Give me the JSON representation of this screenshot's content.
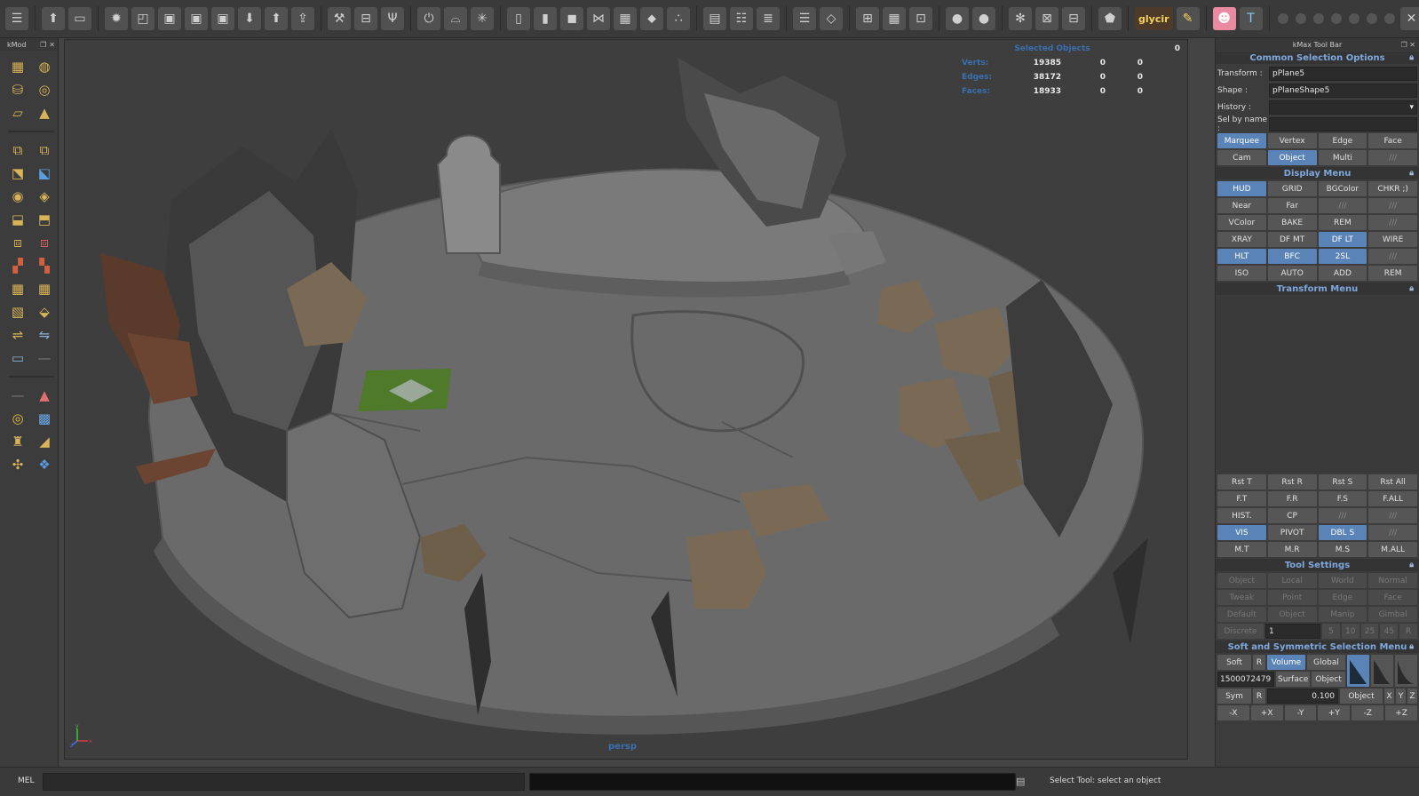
{
  "top_toolbar": {
    "groups": [
      [
        "layers-icon",
        "window-icon"
      ],
      [
        "gear-icon",
        "render-icon",
        "save-icon",
        "save-as-icon",
        "export-icon",
        "download-icon",
        "upload-icon",
        "upload-all-icon"
      ],
      [
        "tools-icon",
        "ruler-icon",
        "usb-icon"
      ],
      [
        "power-icon",
        "bevel-icon",
        "sparkle-icon"
      ],
      [
        "phone-icon",
        "tablet-icon",
        "cube-icon",
        "share-icon",
        "checker-icon",
        "tag-icon",
        "nodes-icon"
      ],
      [
        "table-icon",
        "list-icon",
        "stack-icon"
      ],
      [
        "outliner-icon",
        "plane-icon"
      ],
      [
        "grid-view-icon",
        "grid-icon",
        "uv-icon"
      ],
      [
        "thumbs-up-icon",
        "thumbs-down-icon"
      ],
      [
        "settings-icon",
        "close-x-icon",
        "edit-icon"
      ],
      [
        "pentagon-icon"
      ]
    ],
    "logo_text": "glycir",
    "window_controls": "✕"
  },
  "left_panel": {
    "title": "kMod",
    "rows": 18
  },
  "viewport": {
    "hud": {
      "title": "Selected Objects",
      "title_value": "0",
      "rows": [
        {
          "label": "Verts:",
          "v1": "19385",
          "v2": "0",
          "v3": "0"
        },
        {
          "label": "Edges:",
          "v1": "38172",
          "v2": "0",
          "v3": "0"
        },
        {
          "label": "Faces:",
          "v1": "18933",
          "v2": "0",
          "v3": "0"
        }
      ]
    },
    "camera_name": "persp",
    "axis": {
      "y": "y",
      "x": "x",
      "z": "z"
    }
  },
  "right_panel": {
    "title": "kMax Tool Bar",
    "common_selection": {
      "header": "Common Selection Options",
      "transform_label": "Transform :",
      "transform_value": "pPlane5",
      "shape_label": "Shape :",
      "shape_value": "pPlaneShape5",
      "history_label": "History :",
      "history_value": "",
      "selbyname_label": "Sel by name :",
      "selbyname_value": "",
      "buttons": [
        {
          "label": "Marquee",
          "on": true
        },
        {
          "label": "Vertex",
          "on": false
        },
        {
          "label": "Edge",
          "on": false
        },
        {
          "label": "Face",
          "on": false
        },
        {
          "label": "Cam",
          "on": false
        },
        {
          "label": "Object",
          "on": true
        },
        {
          "label": "Multi",
          "on": false
        },
        {
          "label": "///",
          "on": false
        }
      ]
    },
    "display_menu": {
      "header": "Display Menu",
      "buttons": [
        {
          "label": "HUD",
          "on": true
        },
        {
          "label": "GRID",
          "on": false
        },
        {
          "label": "BGColor",
          "on": false
        },
        {
          "label": "CHKR ;)",
          "on": false
        },
        {
          "label": "Near",
          "on": false
        },
        {
          "label": "Far",
          "on": false
        },
        {
          "label": "///",
          "on": false
        },
        {
          "label": "///",
          "on": false
        },
        {
          "label": "VColor",
          "on": false
        },
        {
          "label": "BAKE",
          "on": false
        },
        {
          "label": "REM",
          "on": false
        },
        {
          "label": "///",
          "on": false
        },
        {
          "label": "XRAY",
          "on": false
        },
        {
          "label": "DF MT",
          "on": false
        },
        {
          "label": "DF LT",
          "on": true
        },
        {
          "label": "WIRE",
          "on": false
        },
        {
          "label": "HLT",
          "on": true
        },
        {
          "label": "BFC",
          "on": true
        },
        {
          "label": "2SL",
          "on": true
        },
        {
          "label": "///",
          "on": false
        },
        {
          "label": "ISO",
          "on": false
        },
        {
          "label": "AUTO",
          "on": false
        },
        {
          "label": "ADD",
          "on": false
        },
        {
          "label": "REM",
          "on": false
        }
      ]
    },
    "transform_menu": {
      "header": "Transform Menu",
      "buttons": [
        {
          "label": "Rst T",
          "on": false
        },
        {
          "label": "Rst R",
          "on": false
        },
        {
          "label": "Rst S",
          "on": false
        },
        {
          "label": "Rst All",
          "on": false
        },
        {
          "label": "F.T",
          "on": false
        },
        {
          "label": "F.R",
          "on": false
        },
        {
          "label": "F.S",
          "on": false
        },
        {
          "label": "F.ALL",
          "on": false
        },
        {
          "label": "HIST.",
          "on": false
        },
        {
          "label": "CP",
          "on": false
        },
        {
          "label": "///",
          "on": false
        },
        {
          "label": "///",
          "on": false
        },
        {
          "label": "VIS",
          "on": true
        },
        {
          "label": "PIVOT",
          "on": false
        },
        {
          "label": "DBL S",
          "on": true
        },
        {
          "label": "///",
          "on": false
        },
        {
          "label": "M.T",
          "on": false
        },
        {
          "label": "M.R",
          "on": false
        },
        {
          "label": "M.S",
          "on": false
        },
        {
          "label": "M.ALL",
          "on": false
        }
      ]
    },
    "tool_settings": {
      "header": "Tool Settings",
      "buttons": [
        {
          "label": "Object"
        },
        {
          "label": "Local"
        },
        {
          "label": "World"
        },
        {
          "label": "Normal"
        },
        {
          "label": "Tweak"
        },
        {
          "label": "Point"
        },
        {
          "label": "Edge"
        },
        {
          "label": "Face"
        },
        {
          "label": "Default"
        },
        {
          "label": "Object"
        },
        {
          "label": "Manip"
        },
        {
          "label": "Gimbal"
        }
      ],
      "discrete_label": "Discrete",
      "discrete_value": "1",
      "snap_values": [
        "5",
        "10",
        "25",
        "45",
        "R"
      ]
    },
    "soft_sym": {
      "header": "Soft and Symmetric Selection Menu",
      "soft_label": "Soft",
      "soft_r": "R",
      "volume_label": "Volume",
      "global_label": "Global",
      "falloff_value": "1500072479",
      "surface_label": "Surface",
      "object_label": "Object",
      "sym_label": "Sym",
      "sym_r": "R",
      "sym_value": "0.100",
      "sym_object_label": "Object",
      "axes": [
        "X",
        "Y",
        "Z"
      ],
      "dirs": [
        "-X",
        "+X",
        "-Y",
        "+Y",
        "-Z",
        "+Z"
      ]
    }
  },
  "status_bar": {
    "mel_label": "MEL",
    "help_text": "Select Tool: select an object"
  }
}
